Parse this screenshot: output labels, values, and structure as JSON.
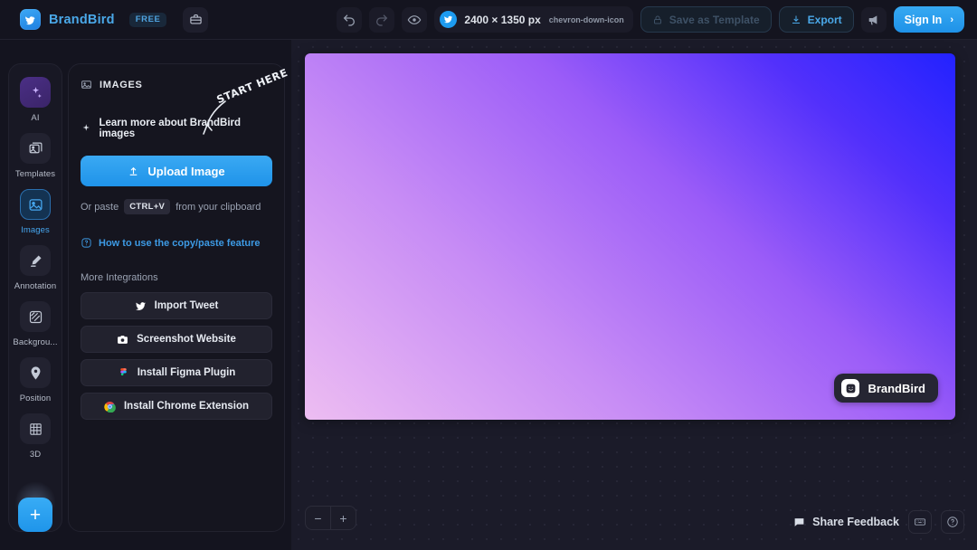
{
  "topbar": {
    "brand_name": "BrandBird",
    "free_badge": "FREE",
    "toolbox_icon": "briefcase-icon",
    "undo_icon": "undo-icon",
    "redo_icon": "redo-icon",
    "preview_icon": "eye-icon",
    "size_platform_icon": "twitter-icon",
    "size_label": "2400 × 1350 px",
    "size_chevron": "chevron-down-icon",
    "save_template_label": "Save as Template",
    "save_template_icon": "lock-icon",
    "export_label": "Export",
    "export_icon": "download-icon",
    "announce_icon": "megaphone-icon",
    "signin_label": "Sign In",
    "signin_arrow": "›"
  },
  "sidebar": {
    "items": [
      {
        "label": "AI",
        "icon": "sparkles-icon"
      },
      {
        "label": "Templates",
        "icon": "templates-icon"
      },
      {
        "label": "Images",
        "icon": "image-icon"
      },
      {
        "label": "Annotation",
        "icon": "marker-icon"
      },
      {
        "label": "Backgrou...",
        "icon": "pattern-icon"
      },
      {
        "label": "Position",
        "icon": "pin-icon"
      },
      {
        "label": "3D",
        "icon": "grid-3d-icon"
      }
    ],
    "add_button_label": "+",
    "add_button_icon": "plus-icon"
  },
  "panel": {
    "title": "IMAGES",
    "title_icon": "image-icon",
    "learn_more_label": "Learn more about BrandBird images",
    "learn_more_icon": "sparkle-icon",
    "annotation_text": "START HERE",
    "upload_label": "Upload Image",
    "upload_icon": "upload-icon",
    "paste_prefix": "Or paste",
    "paste_key": "CTRL+V",
    "paste_suffix": "from your clipboard",
    "howto_label": "How to use the copy/paste feature",
    "howto_icon": "question-badge-icon",
    "more_integrations_label": "More Integrations",
    "integrations": [
      {
        "label": "Import Tweet",
        "icon": "twitter-icon"
      },
      {
        "label": "Screenshot Website",
        "icon": "camera-icon"
      },
      {
        "label": "Install Figma Plugin",
        "icon": "figma-icon"
      },
      {
        "label": "Install Chrome Extension",
        "icon": "chrome-icon"
      }
    ]
  },
  "canvas": {
    "watermark_label": "BrandBird",
    "watermark_icon": "brandbird-icon",
    "zoom_out_label": "−",
    "zoom_in_label": "+",
    "gradient_start": "#edbdf2",
    "gradient_end": "#2222ff"
  },
  "statusbar": {
    "feedback_label": "Share Feedback",
    "feedback_icon": "chat-icon",
    "keyboard_icon": "keyboard-icon",
    "help_icon": "question-circle-icon"
  },
  "colors": {
    "accent": "#1f93e9",
    "link": "#3d9ae4",
    "panel_bg": "#15151f",
    "canvas_bg": "#1b1b29"
  }
}
